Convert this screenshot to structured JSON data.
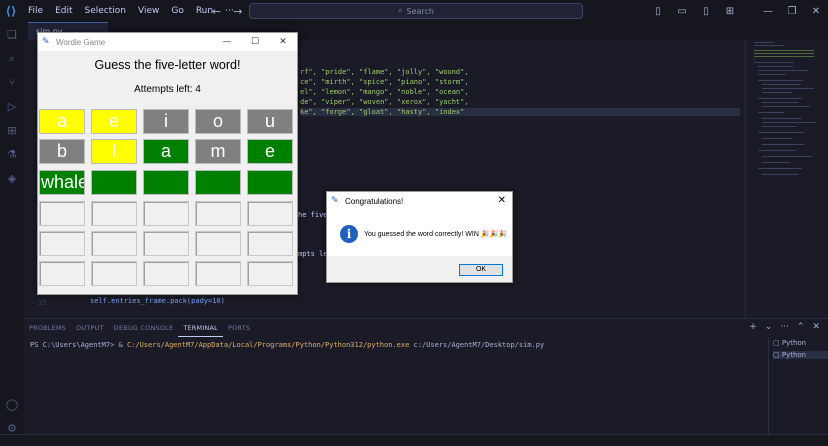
{
  "menu": [
    "File",
    "Edit",
    "Selection",
    "View",
    "Go",
    "Run",
    "···"
  ],
  "search": {
    "label": "Search"
  },
  "tab": {
    "label": "sim.py"
  },
  "code": {
    "line1": "rf\", \"pride\", \"flame\", \"jolly\", \"wound\",",
    "line2": "ce\", \"mirth\", \"spice\", \"piano\", \"storm\",",
    "line3": "el\", \"lemon\", \"mango\", \"noble\", \"ocean\",",
    "line4": "de\", \"viper\", \"woven\", \"xerox\", \"yacht\",",
    "line5": "ke\", \"forge\", \"gloat\", \"hasty\", \"index\"",
    "frag1": "he five-",
    "frag2": "mpts le",
    "lineno": "35",
    "pack_line": "self.entries_frame.pack(pady=10)"
  },
  "panel": {
    "tabs": [
      "PROBLEMS",
      "OUTPUT",
      "DEBUG CONSOLE",
      "TERMINAL",
      "PORTS"
    ],
    "active_tab": "TERMINAL",
    "prompt": "PS C:\\Users\\AgentM7> & ",
    "exe": "C:/Users/AgentM7/AppData/Local/Programs/Python/Python312/python.exe",
    "script": " c:/Users/AgentM7/Desktop/sim.py",
    "terminals": [
      "Python",
      "Python"
    ]
  },
  "wordle": {
    "window_title": "Wordle Game",
    "heading": "Guess the five-letter word!",
    "attempts": "Attempts left: 4",
    "colors": {
      "yellow": "#ffff00",
      "gray": "#808080",
      "green": "#008000",
      "empty": "#f0f0f0"
    },
    "rows": [
      [
        {
          "l": "a",
          "c": "yellow"
        },
        {
          "l": "e",
          "c": "yellow"
        },
        {
          "l": "i",
          "c": "gray"
        },
        {
          "l": "o",
          "c": "gray"
        },
        {
          "l": "u",
          "c": "gray"
        }
      ],
      [
        {
          "l": "b",
          "c": "gray"
        },
        {
          "l": "l",
          "c": "yellow"
        },
        {
          "l": "a",
          "c": "green"
        },
        {
          "l": "m",
          "c": "gray"
        },
        {
          "l": "e",
          "c": "green"
        }
      ],
      [
        {
          "l": "whale",
          "c": "green"
        },
        {
          "l": "",
          "c": "green"
        },
        {
          "l": "",
          "c": "green"
        },
        {
          "l": "",
          "c": "green"
        },
        {
          "l": "",
          "c": "green"
        }
      ],
      [
        {
          "l": "",
          "c": "empty"
        },
        {
          "l": "",
          "c": "empty"
        },
        {
          "l": "",
          "c": "empty"
        },
        {
          "l": "",
          "c": "empty"
        },
        {
          "l": "",
          "c": "empty"
        }
      ],
      [
        {
          "l": "",
          "c": "empty"
        },
        {
          "l": "",
          "c": "empty"
        },
        {
          "l": "",
          "c": "empty"
        },
        {
          "l": "",
          "c": "empty"
        },
        {
          "l": "",
          "c": "empty"
        }
      ],
      [
        {
          "l": "",
          "c": "empty"
        },
        {
          "l": "",
          "c": "empty"
        },
        {
          "l": "",
          "c": "empty"
        },
        {
          "l": "",
          "c": "empty"
        },
        {
          "l": "",
          "c": "empty"
        }
      ]
    ]
  },
  "dialog": {
    "title": "Congratulations!",
    "message": "You guessed the word correctly! WIN 🎉🎉🎉",
    "ok": "OK"
  }
}
